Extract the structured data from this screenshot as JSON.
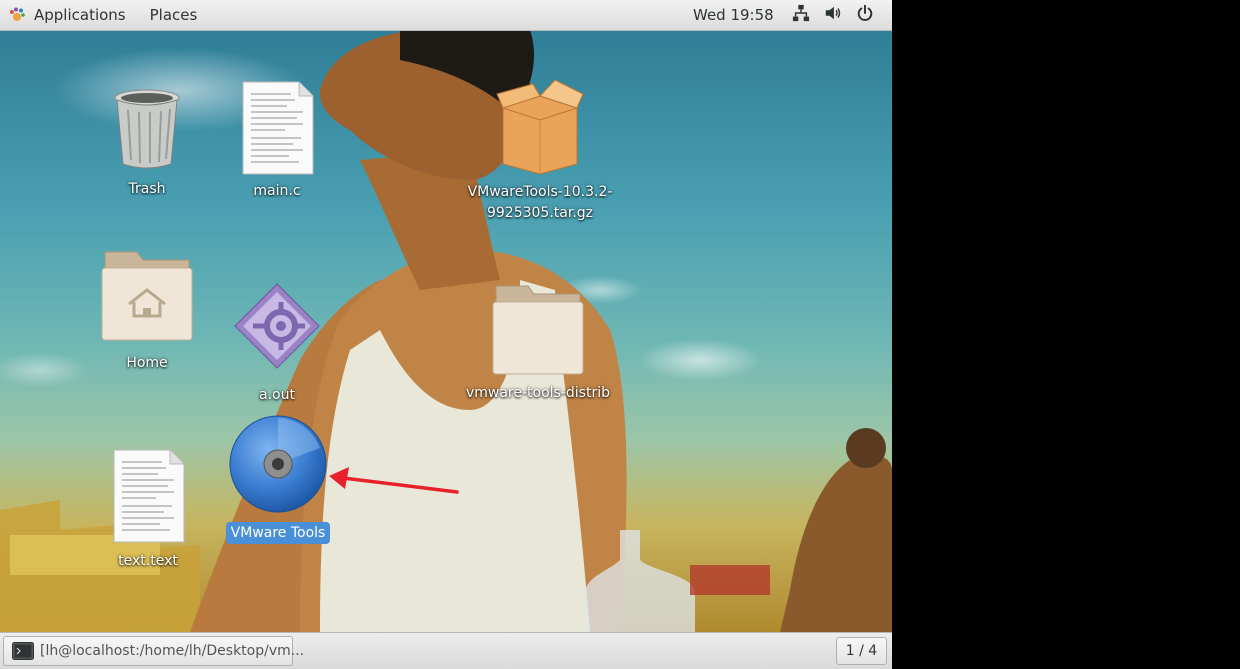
{
  "top_panel": {
    "applications_label": "Applications",
    "places_label": "Places",
    "clock": "Wed 19:58"
  },
  "desktop": {
    "icons": [
      {
        "label": "Trash",
        "icon": "trash-icon"
      },
      {
        "label": "main.c",
        "icon": "text-file-icon"
      },
      {
        "label": "VMwareTools-10.3.2-9925305.tar.gz",
        "label_line1": "VMwareTools-10.3.2-",
        "label_line2": "9925305.tar.gz",
        "icon": "archive-icon"
      },
      {
        "label": "Home",
        "icon": "home-folder-icon"
      },
      {
        "label": "a.out",
        "icon": "executable-icon"
      },
      {
        "label": "vmware-tools-distrib",
        "icon": "folder-icon"
      },
      {
        "label": "text.text",
        "icon": "text-file-icon"
      },
      {
        "label": "VMware Tools",
        "icon": "optical-disc-icon",
        "selected": true
      }
    ]
  },
  "bottom_panel": {
    "window_title": "[lh@localhost:/home/lh/Desktop/vm...",
    "workspace": "1 / 4"
  },
  "colors": {
    "selection": "#4a90d9",
    "annotation_arrow": "#e8202a"
  }
}
